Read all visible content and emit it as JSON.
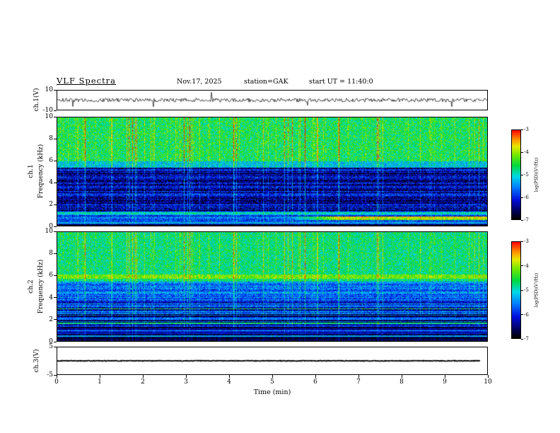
{
  "header": {
    "title": "VLF Spectra",
    "date": "Nov.17, 2025",
    "station": "station=GAK",
    "start_ut": "start UT =  11:40:0"
  },
  "xaxis": {
    "label": "Time (min)",
    "range": [
      0,
      10
    ],
    "ticks": [
      0,
      1,
      2,
      3,
      4,
      5,
      6,
      7,
      8,
      9,
      10
    ]
  },
  "colorbar": {
    "label": "log(PSD)(V²/Hz)",
    "range": [
      -7,
      -3
    ],
    "ticks": [
      -3,
      -4,
      -5,
      -6,
      -7
    ]
  },
  "colormap": {
    "positions": [
      0,
      0.08,
      0.22,
      0.36,
      0.48,
      0.6,
      0.72,
      0.82,
      0.9,
      1.0
    ],
    "colors": [
      "#000000",
      "#000050",
      "#0010dd",
      "#0080ff",
      "#00d8e8",
      "#00d840",
      "#70e800",
      "#e8e800",
      "#ff9000",
      "#ff0800"
    ]
  },
  "chart_data": [
    {
      "panel": "ch1-waveform",
      "type": "line",
      "ylabel": "ch.1(V)",
      "ylim": [
        -10,
        10
      ],
      "yticks": [
        10,
        -10
      ],
      "xlim": [
        0,
        10
      ],
      "description": "Noisy broadband voltage trace fluctuating about 0 V (~±2 V) with sporadic impulsive spikes up to ~±8 V",
      "seed": 20,
      "amplitude": 2.0,
      "spike_prob": 0.015,
      "spike_amp": 6
    },
    {
      "panel": "ch1-spectrogram",
      "type": "heatmap",
      "ylabel_group": "ch.1",
      "ylabel": "Frequency (kHz)",
      "ylim": [
        0,
        10
      ],
      "yticks": [
        0,
        2,
        4,
        6,
        8,
        10
      ],
      "xlim": [
        0,
        10
      ],
      "zlabel": "log(PSD)(V²/Hz)",
      "zlim": [
        -7,
        -3
      ],
      "description": "Bright green band with dense yellow/red vertical sferic streaks above ~6 kHz; dark blue/black region 1.5–5.5 kHz crossed by thin cyan vertical streaks; narrow bright band near 1 kHz; green/yellow-red horizontal band near 0.7 kHz intensifying after ~5.3 min",
      "seed": 11,
      "col_seed": 5,
      "bands": [
        {
          "fmin": 0.6,
          "fmax": 1.01,
          "base": 0.58,
          "noise": 0.14,
          "streak": 0.62
        },
        {
          "fmin": 0.54,
          "fmax": 0.6,
          "base": 0.44,
          "noise": 0.12,
          "streak": 0.5
        },
        {
          "fmin": 0.135,
          "fmax": 0.54,
          "base": 0.15,
          "noise": 0.13,
          "streak": 0.4,
          "hstripe": 0.1
        },
        {
          "fmin": 0.1,
          "fmax": 0.135,
          "base": 0.38,
          "noise": 0.1,
          "streak": 0.25
        },
        {
          "fmin": 0.045,
          "fmax": 0.1,
          "base": 0.26,
          "noise": 0.12,
          "streak": 0.22,
          "hstripe": 0.1
        },
        {
          "fmin": 0.0,
          "fmax": 0.045,
          "base": 0.16,
          "noise": 0.1,
          "streak": 0.15,
          "hstripe": 0.14
        }
      ],
      "lines": [
        {
          "f": 0.072,
          "width": 0.03,
          "boost": 0.45,
          "xstart": 0.53
        },
        {
          "f": 0.028,
          "width": 0.012,
          "boost": 0.28,
          "xstart": 0
        },
        {
          "f": 0.118,
          "width": 0.014,
          "boost": 0.12,
          "xstart": 0
        }
      ]
    },
    {
      "panel": "ch2-spectrogram",
      "type": "heatmap",
      "ylabel_group": "ch.2",
      "ylabel": "Frequency (kHz)",
      "ylim": [
        0,
        10
      ],
      "yticks": [
        0,
        2,
        4,
        6,
        8,
        10
      ],
      "xlim": [
        0,
        10
      ],
      "zlabel": "log(PSD)(V²/Hz)",
      "zlim": [
        -7,
        -3
      ],
      "description": "Green speckled band with vertical sferic streaks above ~6.4 kHz; bright band near 6 kHz; blue region 2.5–5.5 kHz with horizontal striping; darker banded region below 2.5 kHz with thin cyan/green horizontal lines near 2 kHz and 0.5 kHz",
      "seed": 31,
      "col_seed": 5,
      "bands": [
        {
          "fmin": 0.64,
          "fmax": 1.01,
          "base": 0.55,
          "noise": 0.13,
          "streak": 0.55
        },
        {
          "fmin": 0.55,
          "fmax": 0.64,
          "base": 0.55,
          "noise": 0.1,
          "streak": 0.4
        },
        {
          "fmin": 0.4,
          "fmax": 0.55,
          "base": 0.33,
          "noise": 0.12,
          "streak": 0.4,
          "hstripe": 0.1
        },
        {
          "fmin": 0.24,
          "fmax": 0.4,
          "base": 0.24,
          "noise": 0.12,
          "streak": 0.32,
          "hstripe": 0.16
        },
        {
          "fmin": 0.13,
          "fmax": 0.24,
          "base": 0.18,
          "noise": 0.1,
          "streak": 0.26,
          "hstripe": 0.18
        },
        {
          "fmin": 0.0,
          "fmax": 0.13,
          "base": 0.12,
          "noise": 0.08,
          "streak": 0.16,
          "hstripe": 0.14
        }
      ],
      "lines": [
        {
          "f": 0.595,
          "width": 0.035,
          "boost": 0.15,
          "xstart": 0
        },
        {
          "f": 0.3,
          "width": 0.01,
          "boost": 0.18,
          "xstart": 0
        },
        {
          "f": 0.205,
          "width": 0.012,
          "boost": 0.3,
          "xstart": 0
        },
        {
          "f": 0.165,
          "width": 0.01,
          "boost": 0.22,
          "xstart": 0
        },
        {
          "f": 0.05,
          "width": 0.012,
          "boost": 0.26,
          "xstart": 0
        }
      ]
    },
    {
      "panel": "ch3-waveform",
      "type": "line",
      "ylabel": "ch.3(V)",
      "ylim": [
        -5,
        5
      ],
      "yticks": [
        5,
        -5
      ],
      "xlim": [
        0,
        10
      ],
      "description": "Flat thick trace at 0 V ending near 9.85 min",
      "seed": 4,
      "amplitude": 0.12,
      "flat": true,
      "xend": 0.985
    }
  ]
}
